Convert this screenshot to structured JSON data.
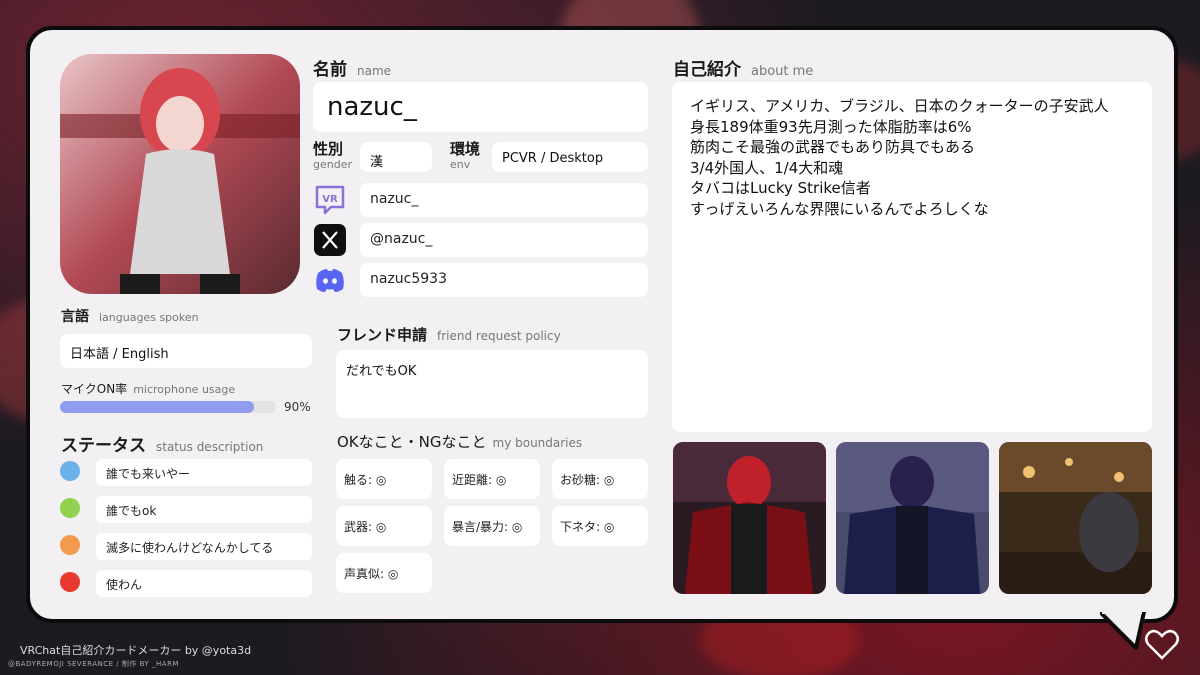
{
  "name_section": {
    "label": "名前",
    "sub": "name",
    "value": "nazuc_"
  },
  "gender": {
    "label": "性別",
    "sub": "gender",
    "value": "漢"
  },
  "env": {
    "label": "環境",
    "sub": "env",
    "value": "PCVR / Desktop"
  },
  "socials": [
    {
      "icon": "vrchat-icon",
      "value": "nazuc_"
    },
    {
      "icon": "x-twitter-icon",
      "value": "@nazuc_"
    },
    {
      "icon": "discord-icon",
      "value": "nazuc5933"
    }
  ],
  "languages": {
    "label": "言語",
    "sub": "languages spoken",
    "value": "日本語 / English"
  },
  "mic": {
    "label": "マイクON率",
    "sub": "microphone usage",
    "percent_text": "90%",
    "percent": 90
  },
  "status": {
    "label": "ステータス",
    "sub": "status description",
    "items": [
      {
        "color": "#6ab0ea",
        "text": "誰でも来いやー"
      },
      {
        "color": "#92d050",
        "text": "誰でもok"
      },
      {
        "color": "#f29b4e",
        "text": "滅多に使わんけどなんかしてる"
      },
      {
        "color": "#e8392f",
        "text": "使わん"
      }
    ]
  },
  "friend_request": {
    "label": "フレンド申請",
    "sub": "friend request policy",
    "value": "だれでもOK"
  },
  "boundaries": {
    "label": "OKなこと・NGなこと",
    "sub": "my boundaries",
    "items": [
      "触る: ◎",
      "近距離: ◎",
      "お砂糖: ◎",
      "武器: ◎",
      "暴言/暴力: ◎",
      "下ネタ: ◎",
      "声真似: ◎"
    ]
  },
  "about": {
    "label": "自己紹介",
    "sub": "about me",
    "lines": [
      "イギリス、アメリカ、ブラジル、日本のクォーターの子安武人",
      "身長189体重93先月測った体脂肪率は6%",
      "筋肉こそ最強の武器でもあり防具でもある",
      "3/4外国人、1/4大和魂",
      "タバコはLucky Strike信者",
      "すっげえいろんな界隈にいるんでよろしくな"
    ]
  },
  "footer": {
    "credit": "VRChat自己紹介カードメーカー by @yota3d",
    "small": "@BADYREMOJI      SEVERANCE / 制作 BY _HARM"
  },
  "colors": {
    "mic_bar": "#8f9cf0",
    "card_bg": "#f2f0f2",
    "border": "#0c0c0c"
  }
}
